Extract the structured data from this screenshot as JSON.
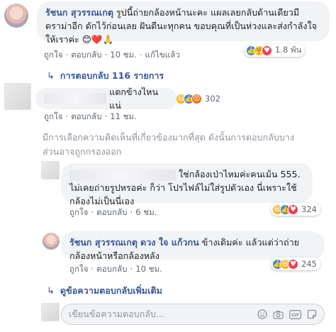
{
  "comment1": {
    "author": "รัชนก สุวรรณเกตุ",
    "text": "รูปนี้ถ่ายกล้องหน้านะคะ แผลเลยกลับด้านเดียวมีดราม่าอีก ดักไว้ก่อนเลย ฝันดีนะทุกคน ขอบคุณที่เป็นห่วงและส่งกำลังใจให้เราค่ะ",
    "emoji": "😊❤️🙏",
    "reaction_count": "1.8 พัน",
    "actions": {
      "like": "ถูกใจ",
      "reply": "ตอบกลับ",
      "time": "10 ชม.",
      "edit": "แก้ไขแล้ว"
    },
    "replies_link": "การตอบกลับ 116 รายการ"
  },
  "comment2": {
    "text": "แตกข้างไหนแน่",
    "reaction_count": "302",
    "actions": {
      "like": "ถูกใจ",
      "reply": "ตอบกลับ",
      "time": "11 ชม."
    }
  },
  "relevance_note": "มีการเลือกความคิดเห็นที่เกี่ยวข้องมากที่สุด ดังนั้นการตอบกลับบางส่วนอาจถูกกรองออก",
  "reply1": {
    "text_line1": "ใช่กล้องเป่าไหมค่ะคนเม้น",
    "text_rest": "555. ไม่เคยถ่ายรูปหรอค่ะ ก็ว่า โปรไฟล์ไม่ใส่รูปตัวเอง นี่เพราะใช้กล้องไม่เป็นนี่เอง",
    "reaction_count": "324",
    "actions": {
      "like": "ถูกใจ",
      "reply": "ตอบกลับ",
      "time": "6 ชม."
    }
  },
  "reply2": {
    "author": "รัชนก สุวรรณเกตุ",
    "mention": "ดวง ใจ แก้วกน",
    "text": "ข้างเดิมค่ะ แล้วแต่ว่าถ่ายกล้องหน้าหรือกล้องหลัง",
    "reaction_count": "245",
    "actions": {
      "like": "ถูกใจ",
      "reply": "ตอบกลับ",
      "time": "10 ชม."
    }
  },
  "more_replies_link": "ดูข้อความตอบกลับเพิ่มเติม",
  "composer": {
    "placeholder": "เขียนข้อความตอบกลับ..."
  },
  "icons": [
    "camera-icon",
    "emoji-icon",
    "gif-icon",
    "sticker-icon",
    "reply-arrow-icon"
  ]
}
